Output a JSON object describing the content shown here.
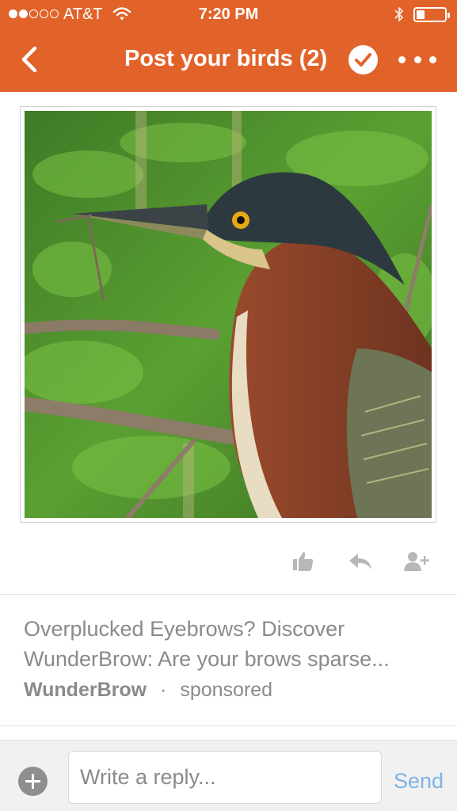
{
  "status_bar": {
    "carrier": "AT&T",
    "time": "7:20 PM",
    "signal_bars_filled": 2,
    "signal_bars_total": 5,
    "battery_level": 0.2
  },
  "nav": {
    "title": "Post your birds (2)",
    "icons": [
      "back-chevron-icon",
      "checkmark-circle-icon",
      "more-dots-icon"
    ]
  },
  "post": {
    "image": "green heron with a twig in its beak, green foliage background",
    "actions": [
      "like-icon",
      "reply-icon",
      "follow-user-icon"
    ]
  },
  "ad": {
    "text": "Overplucked Eyebrows? Discover WunderBrow: Are your brows sparse...",
    "brand": "WunderBrow",
    "separator": "·",
    "label": "sponsored"
  },
  "composer": {
    "placeholder": "Write a reply...",
    "send_label": "Send"
  },
  "colors": {
    "header": "#e2632a",
    "send": "#7fb3e3",
    "muted_text": "#8a8a8a"
  }
}
